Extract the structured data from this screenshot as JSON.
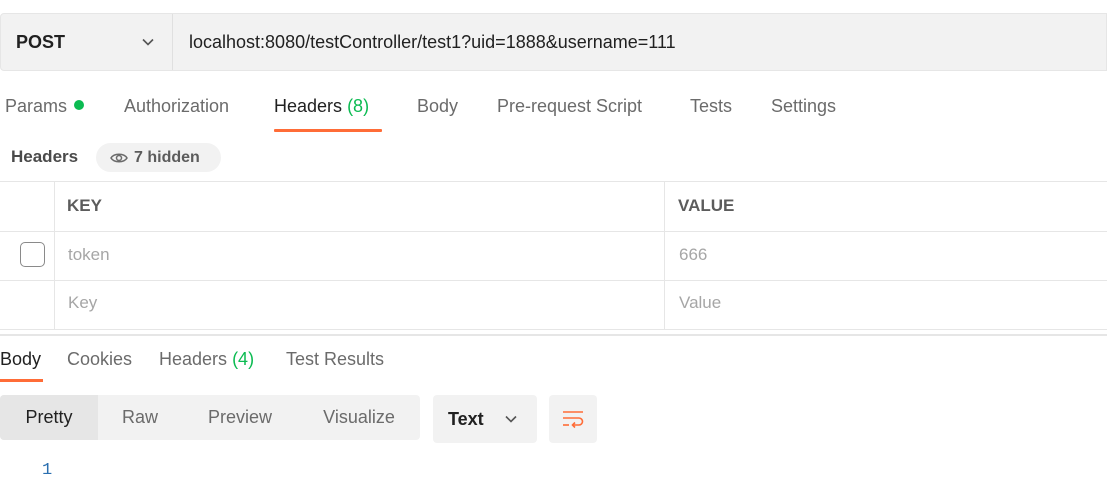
{
  "request": {
    "method": "POST",
    "url": "localhost:8080/testController/test1?uid=1888&username=111"
  },
  "request_tabs": {
    "params": "Params",
    "authorization": "Authorization",
    "headers": "Headers",
    "headers_count": "(8)",
    "body": "Body",
    "pre_request": "Pre-request Script",
    "tests": "Tests",
    "settings": "Settings"
  },
  "headers_section": {
    "title": "Headers",
    "hidden": "7 hidden",
    "columns": {
      "key": "KEY",
      "value": "VALUE"
    },
    "rows": [
      {
        "key": "token",
        "value": "666"
      }
    ],
    "placeholder": {
      "key": "Key",
      "value": "Value"
    }
  },
  "response_tabs": {
    "body": "Body",
    "cookies": "Cookies",
    "headers": "Headers",
    "headers_count": "(4)",
    "test_results": "Test Results"
  },
  "view_modes": [
    "Pretty",
    "Raw",
    "Preview",
    "Visualize"
  ],
  "format": "Text",
  "editor": {
    "line_number": "1"
  },
  "colors": {
    "accent": "#ff6c37",
    "count": "#0cbb52"
  }
}
